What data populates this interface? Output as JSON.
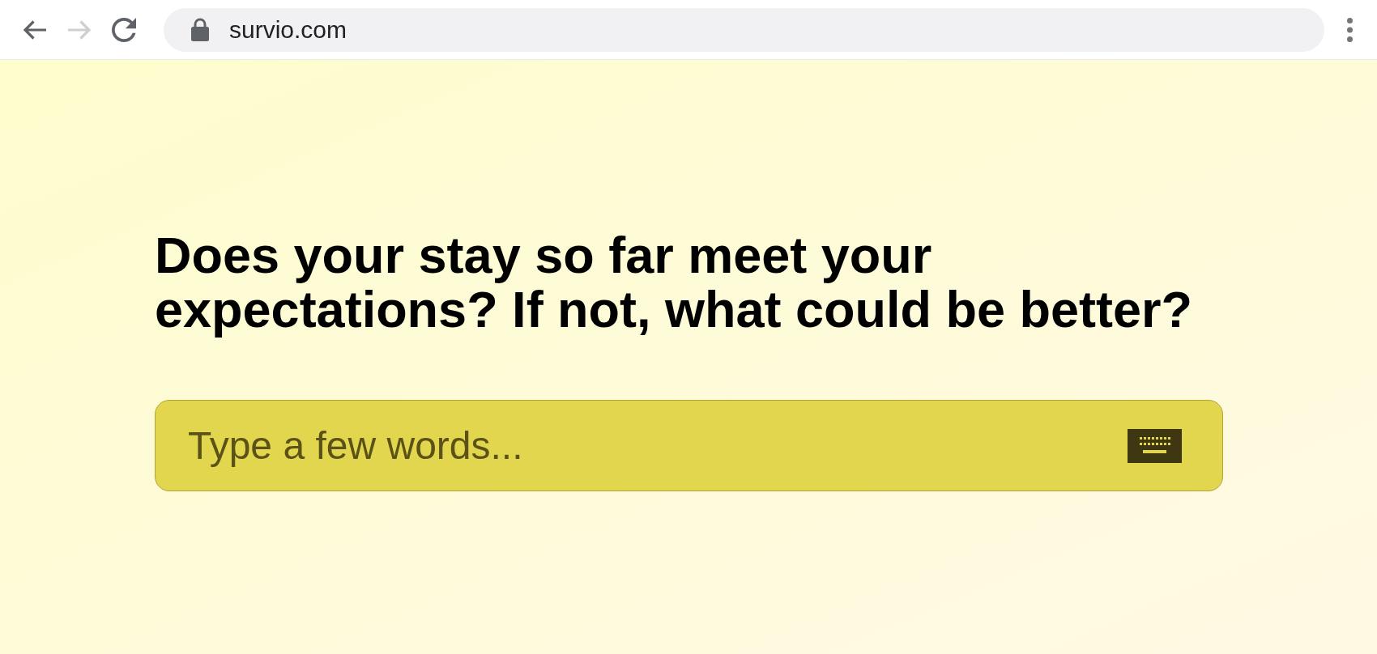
{
  "browser": {
    "nav": [
      {
        "kind": "back",
        "disabled": false
      },
      {
        "kind": "forward",
        "disabled": true
      },
      {
        "kind": "reload",
        "disabled": false
      }
    ],
    "url": "survio.com"
  },
  "question": {
    "title": "Does your stay so far meet your expectations? If not, what could be better?"
  },
  "answer": {
    "placeholder": "Type a few words..."
  }
}
